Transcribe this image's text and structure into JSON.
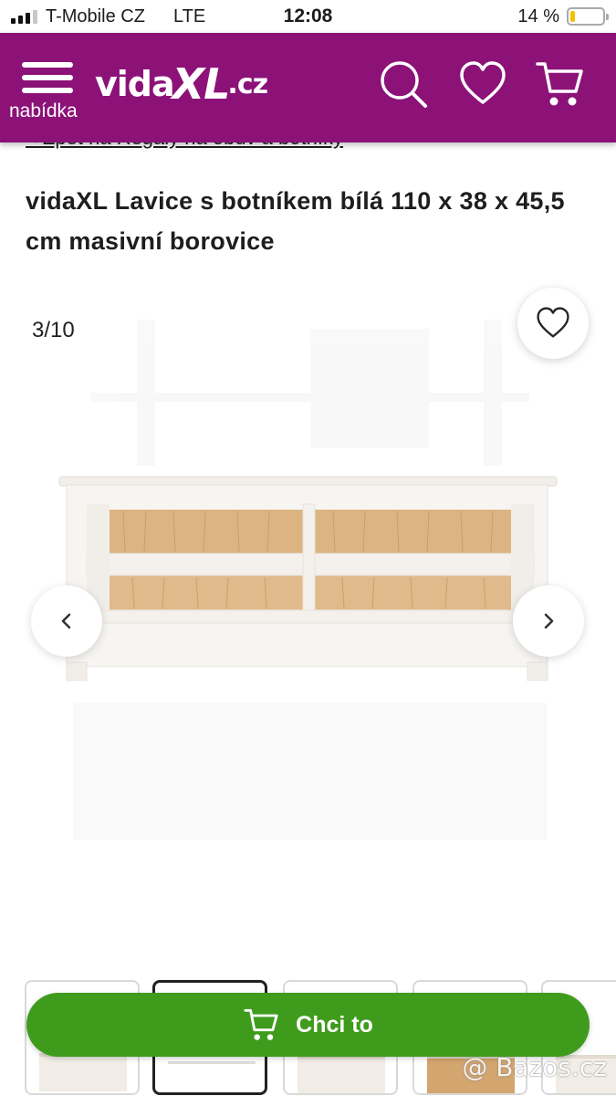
{
  "status_bar": {
    "carrier": "T-Mobile CZ",
    "network": "LTE",
    "time": "12:08",
    "battery": "14 %",
    "battery_level": 0.14,
    "signal_bars": 3
  },
  "header": {
    "menu_label": "nabídka",
    "logo": {
      "prefix": "vida",
      "xl": "XL",
      "suffix": ".cz"
    },
    "icons": [
      "search-icon",
      "heart-icon",
      "cart-icon"
    ],
    "background": "#8c1278"
  },
  "breadcrumb": "< Zpět na Regály na obuv a botníky",
  "product": {
    "title": "vidaXL Lavice s botníkem bílá 110 x 38 x 45,5 cm masivní borovice",
    "image_counter": "3/10"
  },
  "cta": {
    "label": "Chci to",
    "color": "#3f9b1c"
  },
  "watermark": "@ Bazos.cz"
}
